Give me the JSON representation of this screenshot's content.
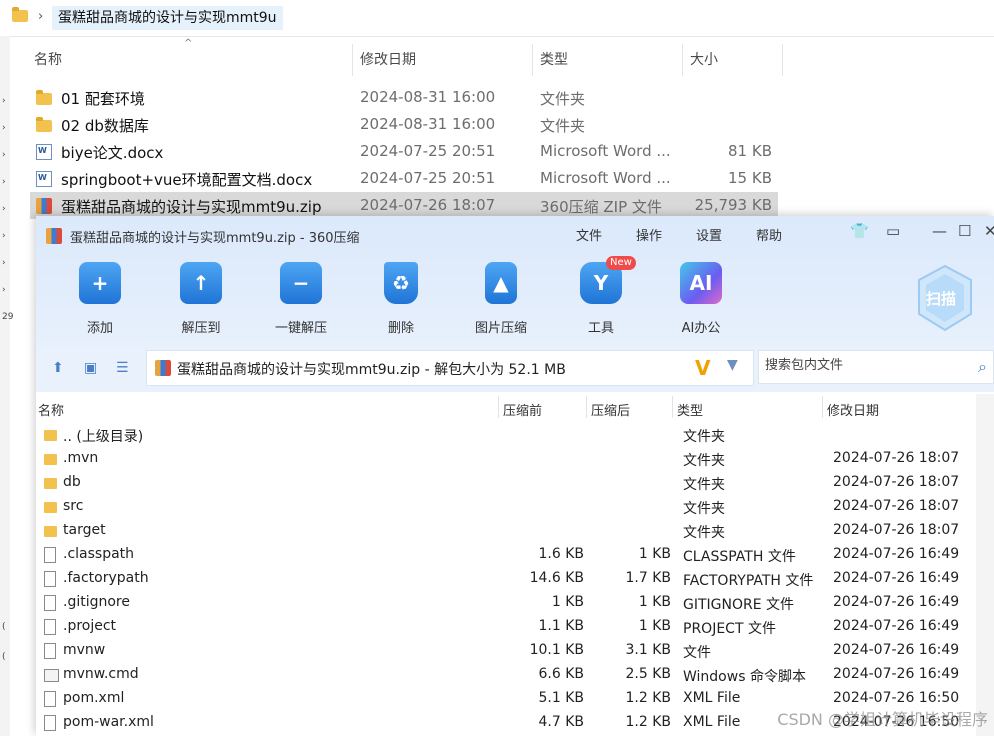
{
  "explorer": {
    "breadcrumb": "蛋糕甜品商城的设计与实现mmt9u",
    "columns": {
      "name": "名称",
      "date": "修改日期",
      "type": "类型",
      "size": "大小"
    },
    "rows": [
      {
        "name": "01 配套环境",
        "date": "2024-08-31 16:00",
        "type": "文件夹",
        "size": "",
        "icon": "folder-icon"
      },
      {
        "name": "02 db数据库",
        "date": "2024-08-31 16:00",
        "type": "文件夹",
        "size": "",
        "icon": "folder-icon"
      },
      {
        "name": "biye论文.docx",
        "date": "2024-07-25 20:51",
        "type": "Microsoft Word ...",
        "size": "81 KB",
        "icon": "word-doc-icon"
      },
      {
        "name": "springboot+vue环境配置文档.docx",
        "date": "2024-07-25 20:51",
        "type": "Microsoft Word ...",
        "size": "15 KB",
        "icon": "word-doc-icon"
      },
      {
        "name": "蛋糕甜品商城的设计与实现mmt9u.zip",
        "date": "2024-07-26 18:07",
        "type": "360压缩 ZIP 文件",
        "size": "25,793 KB",
        "icon": "zip-icon",
        "selected": true
      }
    ]
  },
  "zip": {
    "title": "蛋糕甜品商城的设计与实现mmt9u.zip - 360压缩",
    "menu": [
      "文件",
      "操作",
      "设置",
      "帮助"
    ],
    "tools": [
      {
        "label": "添加",
        "icon": "add-icon"
      },
      {
        "label": "解压到",
        "icon": "extract-to-icon"
      },
      {
        "label": "一键解压",
        "icon": "one-click-extract-icon"
      },
      {
        "label": "删除",
        "icon": "delete-icon"
      },
      {
        "label": "图片压缩",
        "icon": "image-compress-icon"
      },
      {
        "label": "工具",
        "icon": "tools-icon"
      },
      {
        "label": "AI办公",
        "icon": "ai-office-icon"
      }
    ],
    "new_badge": "New",
    "scan_label": "扫描",
    "ai_glyph": "AI",
    "path_text": "蛋糕甜品商城的设计与实现mmt9u.zip - 解包大小为 52.1 MB",
    "search_placeholder": "搜索包内文件",
    "columns": {
      "name": "名称",
      "before": "压缩前",
      "after": "压缩后",
      "type": "类型",
      "date": "修改日期"
    },
    "rows": [
      {
        "name": ".. (上级目录)",
        "before": "",
        "after": "",
        "type": "文件夹",
        "date": "",
        "icon": "folder-icon"
      },
      {
        "name": ".mvn",
        "before": "",
        "after": "",
        "type": "文件夹",
        "date": "2024-07-26 18:07",
        "icon": "folder-icon"
      },
      {
        "name": "db",
        "before": "",
        "after": "",
        "type": "文件夹",
        "date": "2024-07-26 18:07",
        "icon": "folder-icon"
      },
      {
        "name": "src",
        "before": "",
        "after": "",
        "type": "文件夹",
        "date": "2024-07-26 18:07",
        "icon": "folder-icon"
      },
      {
        "name": "target",
        "before": "",
        "after": "",
        "type": "文件夹",
        "date": "2024-07-26 18:07",
        "icon": "folder-icon"
      },
      {
        "name": ".classpath",
        "before": "1.6 KB",
        "after": "1 KB",
        "type": "CLASSPATH 文件",
        "date": "2024-07-26 16:49",
        "icon": "file-icon"
      },
      {
        "name": ".factorypath",
        "before": "14.6 KB",
        "after": "1.7 KB",
        "type": "FACTORYPATH 文件",
        "date": "2024-07-26 16:49",
        "icon": "file-icon"
      },
      {
        "name": ".gitignore",
        "before": "1 KB",
        "after": "1 KB",
        "type": "GITIGNORE 文件",
        "date": "2024-07-26 16:49",
        "icon": "file-icon"
      },
      {
        "name": ".project",
        "before": "1.1 KB",
        "after": "1 KB",
        "type": "PROJECT 文件",
        "date": "2024-07-26 16:49",
        "icon": "file-icon"
      },
      {
        "name": "mvnw",
        "before": "10.1 KB",
        "after": "3.1 KB",
        "type": "文件",
        "date": "2024-07-26 16:49",
        "icon": "file-icon"
      },
      {
        "name": "mvnw.cmd",
        "before": "6.6 KB",
        "after": "2.5 KB",
        "type": "Windows 命令脚本",
        "date": "2024-07-26 16:49",
        "icon": "cmd-script-icon"
      },
      {
        "name": "pom.xml",
        "before": "5.1 KB",
        "after": "1.2 KB",
        "type": "XML File",
        "date": "2024-07-26 16:50",
        "icon": "file-icon"
      },
      {
        "name": "pom-war.xml",
        "before": "4.7 KB",
        "after": "1.2 KB",
        "type": "XML File",
        "date": "2024-07-26 16:50",
        "icon": "file-icon"
      }
    ]
  },
  "watermark": "CSDN @学姐计算机毕设程序",
  "left_strip_chars": [
    "›",
    "›",
    "›",
    "›",
    "›",
    "›",
    "›",
    "›",
    "29",
    "(",
    "("
  ],
  "colors": {
    "accent": "#1f74d6",
    "selection": "#d9d9d9",
    "folder": "#f3c24e"
  }
}
